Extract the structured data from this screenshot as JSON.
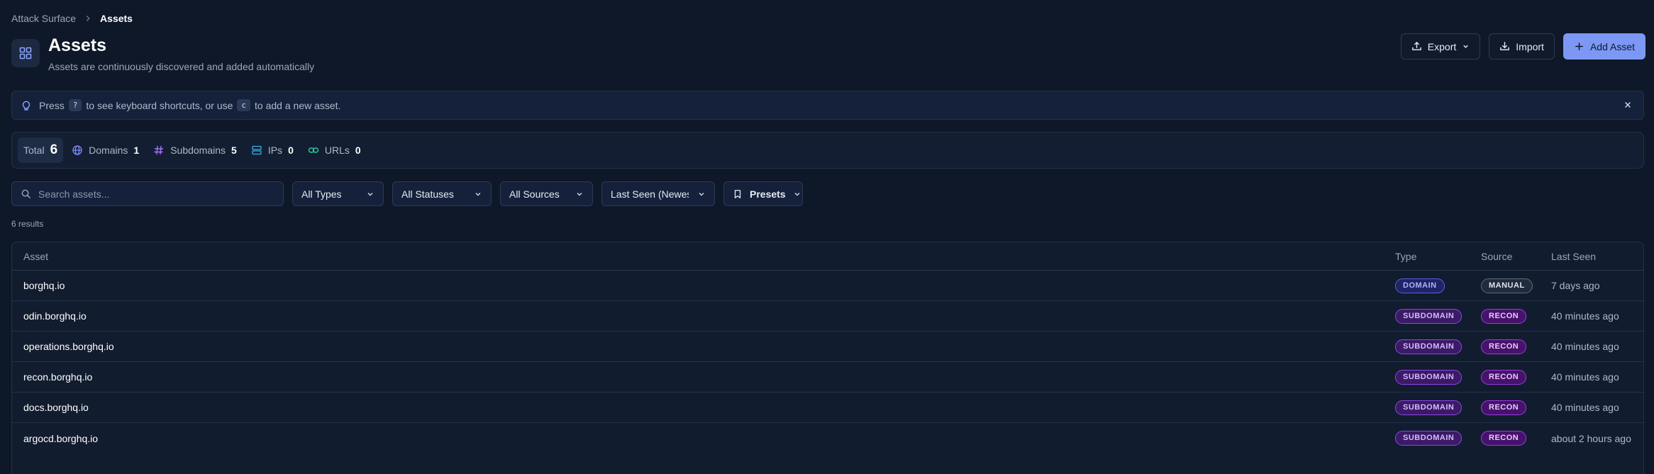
{
  "breadcrumb": {
    "parent": "Attack Surface",
    "current": "Assets"
  },
  "header": {
    "title": "Assets",
    "subtitle": "Assets are continuously discovered and added automatically",
    "export_label": "Export",
    "import_label": "Import",
    "add_label": "Add Asset"
  },
  "hint": {
    "text_1": "Press",
    "key_1": "?",
    "text_2": "to see keyboard shortcuts, or use",
    "key_2": "c",
    "text_3": "to add a new asset."
  },
  "stats": {
    "total_label": "Total",
    "total_count": "6",
    "domains_label": "Domains",
    "domains_count": "1",
    "subdomains_label": "Subdomains",
    "subdomains_count": "5",
    "ips_label": "IPs",
    "ips_count": "0",
    "urls_label": "URLs",
    "urls_count": "0"
  },
  "filters": {
    "search_placeholder": "Search assets...",
    "types": "All Types",
    "statuses": "All Statuses",
    "sources": "All Sources",
    "sort": "Last Seen (Newest first)",
    "presets": "Presets"
  },
  "results_count": "6 results",
  "table": {
    "headers": {
      "asset": "Asset",
      "type": "Type",
      "source": "Source",
      "last_seen": "Last Seen"
    },
    "rows": [
      {
        "asset": "borghq.io",
        "type": "DOMAIN",
        "source": "MANUAL",
        "last_seen": "7 days ago"
      },
      {
        "asset": "odin.borghq.io",
        "type": "SUBDOMAIN",
        "source": "RECON",
        "last_seen": "40 minutes ago"
      },
      {
        "asset": "operations.borghq.io",
        "type": "SUBDOMAIN",
        "source": "RECON",
        "last_seen": "40 minutes ago"
      },
      {
        "asset": "recon.borghq.io",
        "type": "SUBDOMAIN",
        "source": "RECON",
        "last_seen": "40 minutes ago"
      },
      {
        "asset": "docs.borghq.io",
        "type": "SUBDOMAIN",
        "source": "RECON",
        "last_seen": "40 minutes ago"
      },
      {
        "asset": "argocd.borghq.io",
        "type": "SUBDOMAIN",
        "source": "RECON",
        "last_seen": "about 2 hours ago"
      }
    ]
  },
  "colors": {
    "background": "#0f1828",
    "accent": "#7c98f4",
    "domain_badge": "#5b5ee0",
    "subdomain_badge": "#8b47e8",
    "recon_badge": "#9b3be2"
  },
  "icons": {
    "page": "grid-icon",
    "export": "upload-icon",
    "import": "download-icon",
    "add": "plus-icon",
    "hint": "lightbulb-icon",
    "close": "close-icon",
    "domains": "globe-icon",
    "subdomains": "hash-icon",
    "ips": "server-icon",
    "urls": "link-icon",
    "search": "search-icon",
    "presets": "bookmark-icon"
  }
}
